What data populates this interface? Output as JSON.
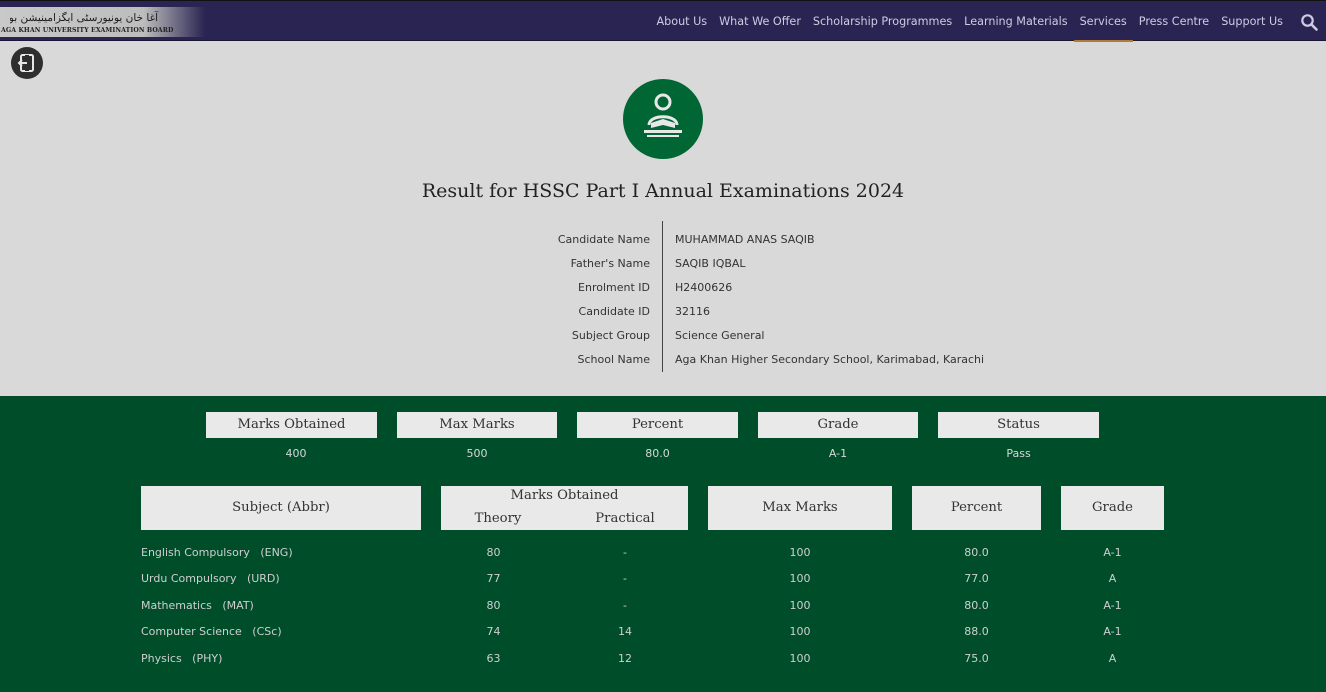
{
  "header": {
    "logo_text": "AGA KHAN UNIVERSITY EXAMINATION BOARD",
    "logo_urdu": "آغا خان یونیورسٹی ایگزامینیشن بورڈ",
    "nav": [
      {
        "label": "About Us",
        "active": false
      },
      {
        "label": "What We Offer",
        "active": false
      },
      {
        "label": "Scholarship Programmes",
        "active": false
      },
      {
        "label": "Learning Materials",
        "active": false
      },
      {
        "label": "Services",
        "active": true
      },
      {
        "label": "Press Centre",
        "active": false
      },
      {
        "label": "Support Us",
        "active": false
      }
    ],
    "search_icon": "search-icon"
  },
  "page": {
    "back_icon": "logout-icon",
    "emblem_icon": "reader-icon",
    "title": "Result for HSSC Part I Annual Examinations 2024"
  },
  "candidate": [
    {
      "label": "Candidate Name",
      "value": "MUHAMMAD ANAS SAQIB"
    },
    {
      "label": "Father's Name",
      "value": "SAQIB IQBAL"
    },
    {
      "label": "Enrolment ID",
      "value": "H2400626"
    },
    {
      "label": "Candidate ID",
      "value": "32116"
    },
    {
      "label": "Subject Group",
      "value": "Science General"
    },
    {
      "label": "School Name",
      "value": "Aga Khan Higher Secondary School, Karimabad, Karachi"
    }
  ],
  "summary": {
    "headers": [
      "Marks Obtained",
      "Max Marks",
      "Percent",
      "Grade",
      "Status"
    ],
    "values": [
      "400",
      "500",
      "80.0",
      "A-1",
      "Pass"
    ]
  },
  "table": {
    "headers": {
      "subject": "Subject  (Abbr)",
      "marks_obtained": "Marks Obtained",
      "theory": "Theory",
      "practical": "Practical",
      "max_marks": "Max Marks",
      "percent": "Percent",
      "grade": "Grade"
    },
    "rows": [
      {
        "subject": "English Compulsory   (ENG)",
        "theory": "80",
        "practical": "-",
        "max": "100",
        "percent": "80.0",
        "grade": "A-1"
      },
      {
        "subject": "Urdu Compulsory   (URD)",
        "theory": "77",
        "practical": "-",
        "max": "100",
        "percent": "77.0",
        "grade": "A"
      },
      {
        "subject": "Mathematics   (MAT)",
        "theory": "80",
        "practical": "-",
        "max": "100",
        "percent": "80.0",
        "grade": "A-1"
      },
      {
        "subject": "Computer Science   (CSc)",
        "theory": "74",
        "practical": "14",
        "max": "100",
        "percent": "88.0",
        "grade": "A-1"
      },
      {
        "subject": "Physics   (PHY)",
        "theory": "63",
        "practical": "12",
        "max": "100",
        "percent": "75.0",
        "grade": "A"
      }
    ]
  },
  "colors": {
    "nav_bg": "#2a2452",
    "brand_green": "#006633",
    "section_green": "#004d2a",
    "active_underline": "#b07a3a"
  }
}
